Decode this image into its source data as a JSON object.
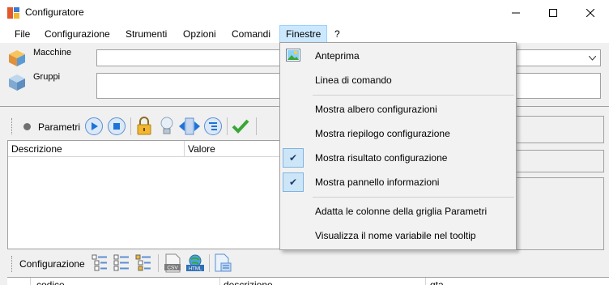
{
  "window": {
    "title": "Configuratore"
  },
  "menubar": {
    "items": [
      "File",
      "Configurazione",
      "Strumenti",
      "Opzioni",
      "Comandi",
      "Finestre",
      "?"
    ]
  },
  "fields": {
    "machines_label": "Macchine",
    "groups_label": "Gruppi"
  },
  "params_toolbar": {
    "label": "Parametri"
  },
  "params_grid": {
    "columns": [
      "Descrizione",
      "Valore"
    ]
  },
  "config_toolbar": {
    "label": "Configurazione"
  },
  "bottom_grid": {
    "columns": [
      "codice",
      "descrizione",
      "qta"
    ]
  },
  "icons": {
    "csv": "CSV",
    "html": "HTML"
  },
  "finestre_menu": {
    "items": [
      {
        "label": "Anteprima",
        "checked": false
      },
      {
        "label": "Linea di comando",
        "checked": false
      },
      {
        "label": "Mostra albero configurazioni",
        "checked": false
      },
      {
        "label": "Mostra riepilogo configurazione",
        "checked": false
      },
      {
        "label": "Mostra risultato configurazione",
        "checked": true
      },
      {
        "label": "Mostra pannello informazioni",
        "checked": true
      },
      {
        "label": "Adatta le colonne della griglia Parametri",
        "checked": false
      },
      {
        "label": "Visualizza il nome variabile nel tooltip",
        "checked": false
      }
    ]
  },
  "colors": {
    "menu_highlight": "#cce8ff",
    "check_bg": "#cde6f7",
    "accent_blue": "#1e73d8"
  }
}
